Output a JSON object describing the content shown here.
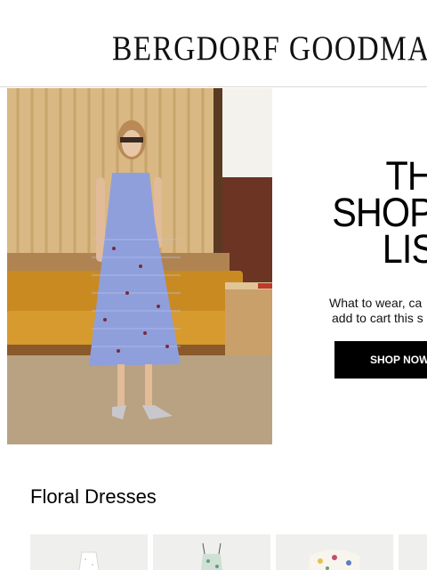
{
  "header": {
    "logo_text": "BERGDORF GOODMAN"
  },
  "hero": {
    "title_lines": [
      "THE",
      "SHOPP",
      "LIST"
    ],
    "subtitle_lines": [
      "What to wear, ca",
      "add to cart this s"
    ],
    "cta_label": "SHOP NOW",
    "image": "woman-in-gingham-dress-on-sofa"
  },
  "section": {
    "title": "Floral Dresses"
  },
  "products": [
    {
      "image": "white-dress-thumbnail"
    },
    {
      "image": "green-floral-dress-thumbnail"
    },
    {
      "image": "floral-print-dress-thumbnail"
    },
    {
      "image": "partial-product-thumbnail"
    }
  ],
  "colors": {
    "background": "#ffffff",
    "cta_background": "#000000",
    "cta_text": "#ffffff",
    "card_background": "#efefed"
  }
}
